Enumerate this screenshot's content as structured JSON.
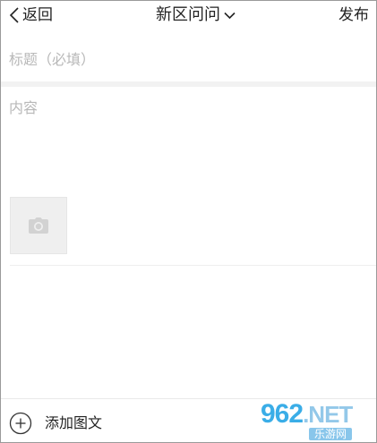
{
  "header": {
    "back_label": "返回",
    "title": "新区问问",
    "publish_label": "发布"
  },
  "form": {
    "title_placeholder": "标题（必填）",
    "title_value": "",
    "content_placeholder": "内容",
    "content_value": ""
  },
  "bottom_bar": {
    "add_label": "添加图文"
  },
  "watermark": {
    "logo": "962",
    "logo_suffix": ".NET",
    "sub": "乐游网"
  },
  "icons": {
    "back": "chevron-left-icon",
    "title_dropdown": "chevron-down-icon",
    "photo": "camera-icon",
    "add": "plus-circle-icon"
  },
  "colors": {
    "placeholder": "#b8b8b8",
    "photo_tile": "#efefef",
    "divider": "#f2f2f2"
  }
}
